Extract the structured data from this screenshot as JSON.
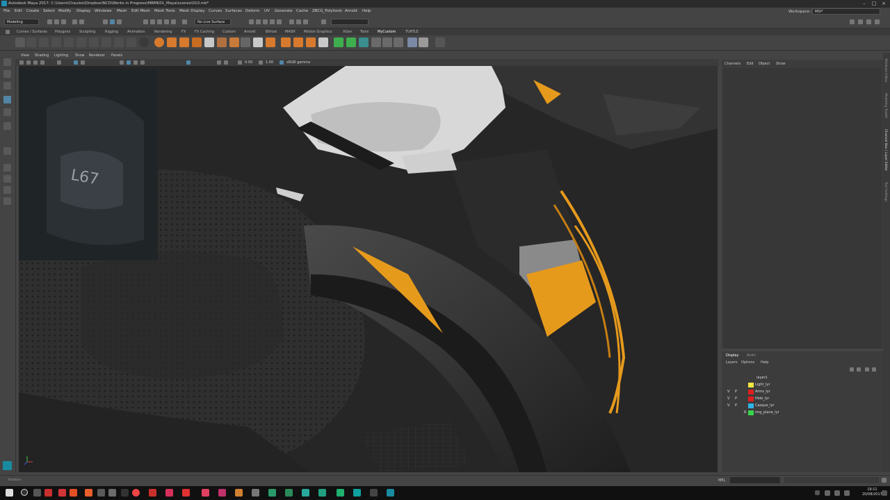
{
  "window": {
    "title": "Autodesk Maya 2017: C:\\Users\\Cheuloo\\Dropbox\\NCD\\Works in Progress\\MRMK01_Maya\\scenes\\010.mb*"
  },
  "menubar": {
    "items": [
      "File",
      "Edit",
      "Create",
      "Select",
      "Modify",
      "Display",
      "Windows",
      "Mesh",
      "Edit Mesh",
      "Mesh Tools",
      "Mesh Display",
      "Curves",
      "Surfaces",
      "Deform",
      "UV",
      "Generate",
      "Cache",
      "ZBCG_Polytools",
      "Arnold",
      "Help"
    ],
    "workspace_label": "Workspace :",
    "workspace_value": "MSI*"
  },
  "statusline": {
    "mode": "Modeling",
    "live_surface": "No Live Surface"
  },
  "shelf": {
    "tabs": [
      "Curves / Surfaces",
      "Polygons",
      "Sculpting",
      "Rigging",
      "Animation",
      "Rendering",
      "FX",
      "FX Caching",
      "Custom",
      "Arnold",
      "Bifrost",
      "MASH",
      "Motion Graphics",
      "XGen",
      "Tools",
      "MyCustom",
      "TURTLE"
    ],
    "active_tab": "MyCustom"
  },
  "viewport": {
    "menu": [
      "View",
      "Shading",
      "Lighting",
      "Show",
      "Renderer",
      "Panels"
    ],
    "near_value": "0.00",
    "far_value": "1.00",
    "color_space": "sRGB gamma",
    "decal_text": "L67",
    "colors": {
      "accent": "#e69a1c",
      "body": "#3a3a3a",
      "background": "#262626"
    }
  },
  "channelbox": {
    "menu": [
      "Channels",
      "Edit",
      "Object",
      "Show"
    ]
  },
  "layers": {
    "tabs": [
      "Display",
      "Anim"
    ],
    "menu": [
      "Layers",
      "Options",
      "Help"
    ],
    "items": [
      {
        "v": "",
        "p": "",
        "name": "layer1",
        "color": ""
      },
      {
        "v": "",
        "p": "",
        "name": "Light_lyr",
        "color": "#f5e642"
      },
      {
        "v": "V",
        "p": "P",
        "name": "Arms_lyr",
        "color": "#e01e1e"
      },
      {
        "v": "V",
        "p": "P",
        "name": "Hide_lyr",
        "color": "#e01e1e"
      },
      {
        "v": "V",
        "p": "P",
        "name": "Casque_lyr",
        "color": "#2fb4e6"
      },
      {
        "v": "",
        "p": "R",
        "name": "img_plane_lyr",
        "color": "#38d64a"
      }
    ]
  },
  "right_strip": [
    "Attribute Editor",
    "Modeling Toolkit",
    "Channel Box / Layer Editor",
    "Tool Settings"
  ],
  "bottom": {
    "rotation_label": "Rotation",
    "mel_label": "MEL"
  },
  "taskbar": {
    "time": "19:11",
    "date": "20/08/2017"
  }
}
